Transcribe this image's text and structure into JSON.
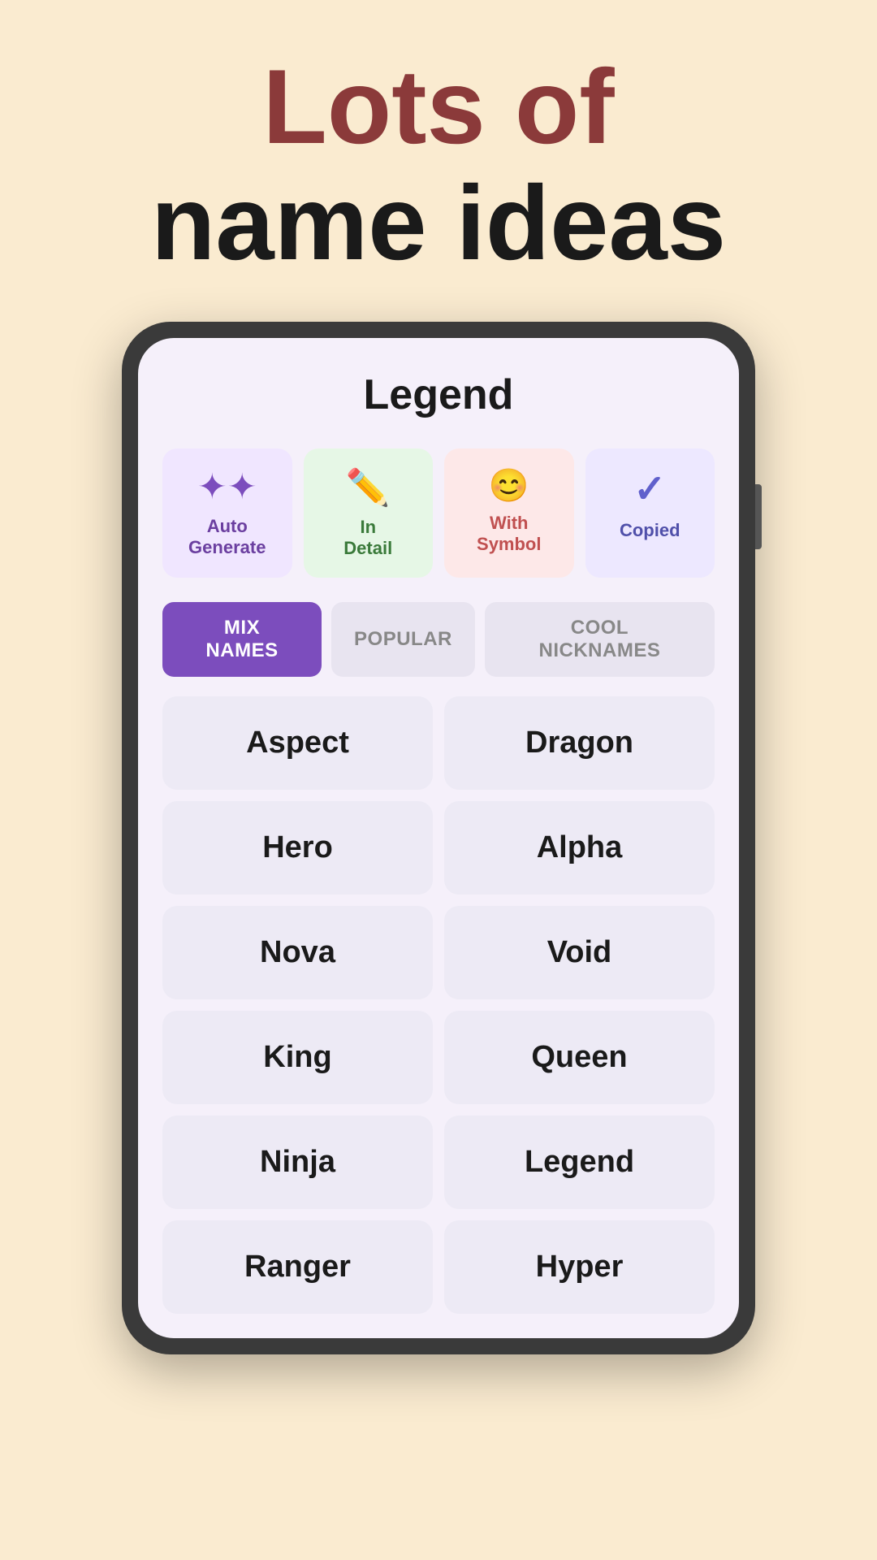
{
  "background_color": "#faebd0",
  "headline": {
    "line1": "Lots of",
    "line2": "name ideas"
  },
  "app": {
    "title": "Legend"
  },
  "legend_items": [
    {
      "key": "auto-generate",
      "icon": "wand",
      "label_line1": "Auto",
      "label_line2": "Generate",
      "bg_color": "#f0e6ff",
      "text_color": "#6b3fa0"
    },
    {
      "key": "in-detail",
      "icon": "pencil",
      "label_line1": "In",
      "label_line2": "Detail",
      "bg_color": "#e6f7e6",
      "text_color": "#3a7a3a"
    },
    {
      "key": "with-symbol",
      "icon": "smiley",
      "label_line1": "With",
      "label_line2": "Symbol",
      "bg_color": "#fde8e8",
      "text_color": "#c05050"
    },
    {
      "key": "copied",
      "icon": "check",
      "label_line1": "Copied",
      "label_line2": "",
      "bg_color": "#ede8ff",
      "text_color": "#5050aa"
    }
  ],
  "tabs": [
    {
      "label": "MIX NAMES",
      "active": true
    },
    {
      "label": "POPULAR",
      "active": false
    },
    {
      "label": "COOL NICKNAMES",
      "active": false
    }
  ],
  "names": [
    {
      "col": 0,
      "text": "Aspect"
    },
    {
      "col": 1,
      "text": "Dragon"
    },
    {
      "col": 0,
      "text": "Hero"
    },
    {
      "col": 1,
      "text": "Alpha"
    },
    {
      "col": 0,
      "text": "Nova"
    },
    {
      "col": 1,
      "text": "Void"
    },
    {
      "col": 0,
      "text": "King"
    },
    {
      "col": 1,
      "text": "Queen"
    },
    {
      "col": 0,
      "text": "Ninja"
    },
    {
      "col": 1,
      "text": "Legend"
    },
    {
      "col": 0,
      "text": "Ranger"
    },
    {
      "col": 1,
      "text": "Hyper"
    }
  ]
}
